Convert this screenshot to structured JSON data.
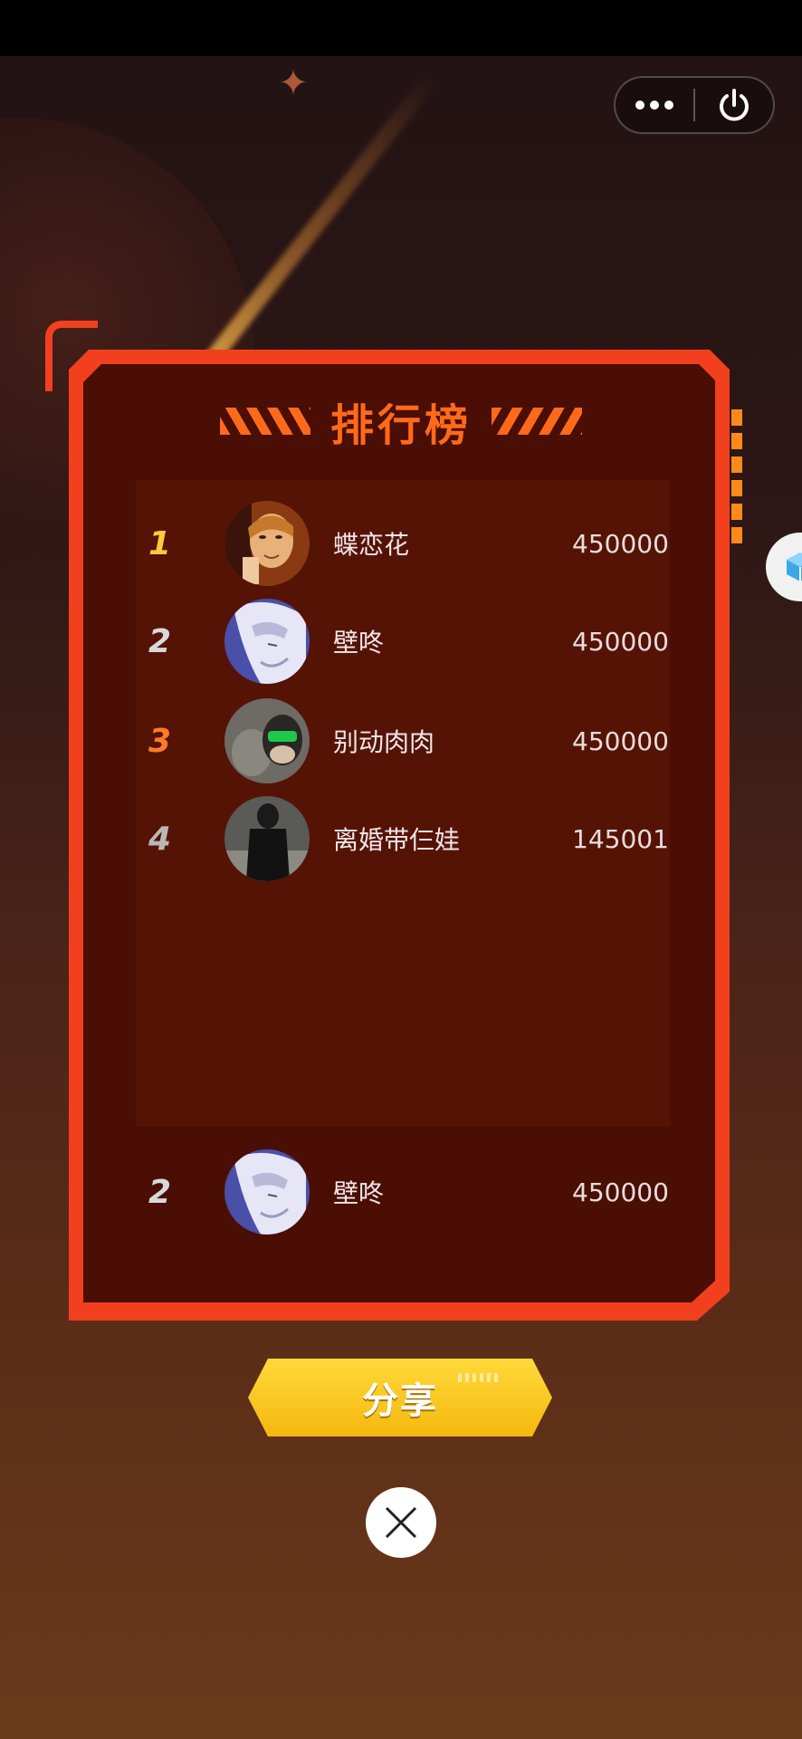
{
  "header": {
    "capsule": {
      "more_icon": "more-dots-icon",
      "exit_icon": "power-icon"
    }
  },
  "panel": {
    "title": "排行榜",
    "accent_color": "#f2401e",
    "inner_color": "#4a0e05"
  },
  "leaderboard": {
    "entries": [
      {
        "rank": "1",
        "name": "蝶恋花",
        "score": "450000",
        "rank_color": "#ffc93a"
      },
      {
        "rank": "2",
        "name": "壁咚",
        "score": "450000",
        "rank_color": "#d9d9d9"
      },
      {
        "rank": "3",
        "name": "别动肉肉",
        "score": "450000",
        "rank_color": "#ff7a2a"
      },
      {
        "rank": "4",
        "name": "离婚带仨娃",
        "score": "145001",
        "rank_color": "#b8b8b8"
      }
    ],
    "self": {
      "rank": "2",
      "name": "壁咚",
      "score": "450000",
      "rank_color": "#d9d9d9"
    }
  },
  "actions": {
    "share_label": "分享",
    "close_icon": "close-icon"
  },
  "floating": {
    "icon": "cube-icon"
  }
}
